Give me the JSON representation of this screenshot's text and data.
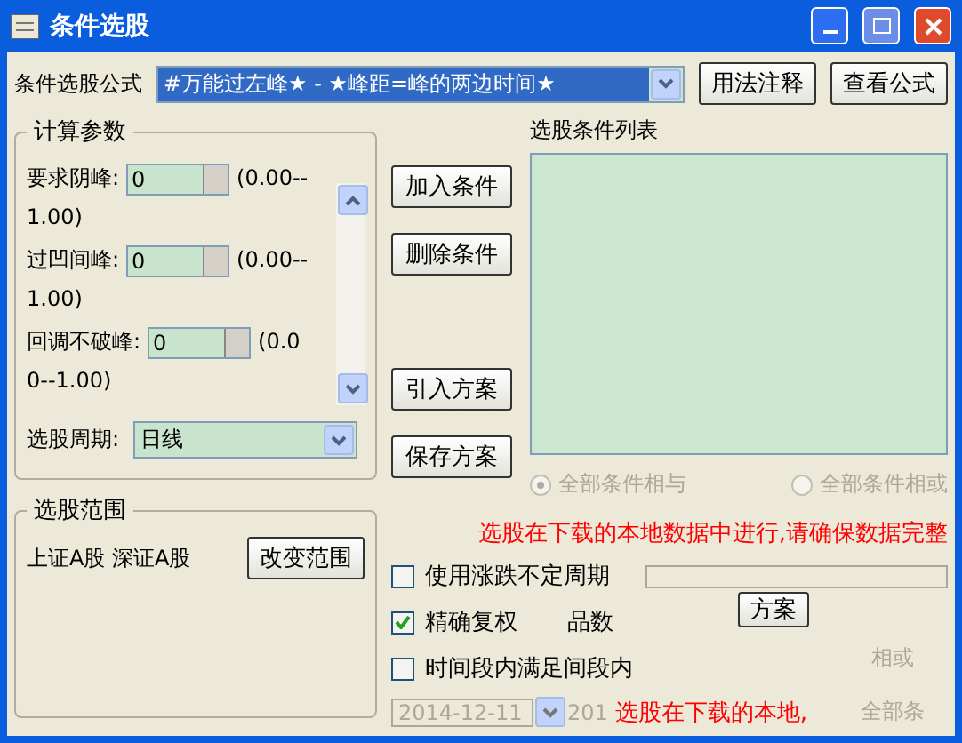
{
  "window": {
    "title": "条件选股"
  },
  "formula": {
    "label": "条件选股公式",
    "value": "#万能过左峰★ - ★峰距=峰的两边时间★"
  },
  "top_buttons": [
    "用法注释",
    "查看公式"
  ],
  "params": {
    "title": "计算参数",
    "items": [
      {
        "label": "要求阴峰:",
        "value": "0",
        "range": "(0.00--1.00)"
      },
      {
        "label": "过凹间峰:",
        "value": "0",
        "range": "(0.00--1.00)"
      },
      {
        "label": "回调不破峰:",
        "value": "0",
        "range": "(0.00--1.00)"
      }
    ],
    "period": {
      "label": "选股周期:",
      "value": "日线"
    }
  },
  "range": {
    "title": "选股范围",
    "markets": "上证A股 深证A股",
    "button": "改变范围"
  },
  "actions": [
    "加入条件",
    "删除条件",
    "引入方案",
    "保存方案"
  ],
  "list": {
    "title": "选股条件列表"
  },
  "logic": [
    {
      "label": "全部条件相与",
      "selected": true
    },
    {
      "label": "全部条件相或",
      "selected": false
    }
  ],
  "notice": "选股在下载的本地数据中进行,请确保数据完整",
  "options": [
    {
      "label": "使用涨跌不定周期",
      "checked": false
    },
    {
      "label": "精确复权",
      "checked": true
    },
    {
      "label": "时间段内满足间段内",
      "checked": false
    }
  ],
  "ghost": {
    "label": "品数",
    "button": "方案",
    "date": "2014-12-11",
    "date2": "201",
    "notice": "选股在下载的本地,",
    "all": "全部条",
    "or": "相或"
  }
}
